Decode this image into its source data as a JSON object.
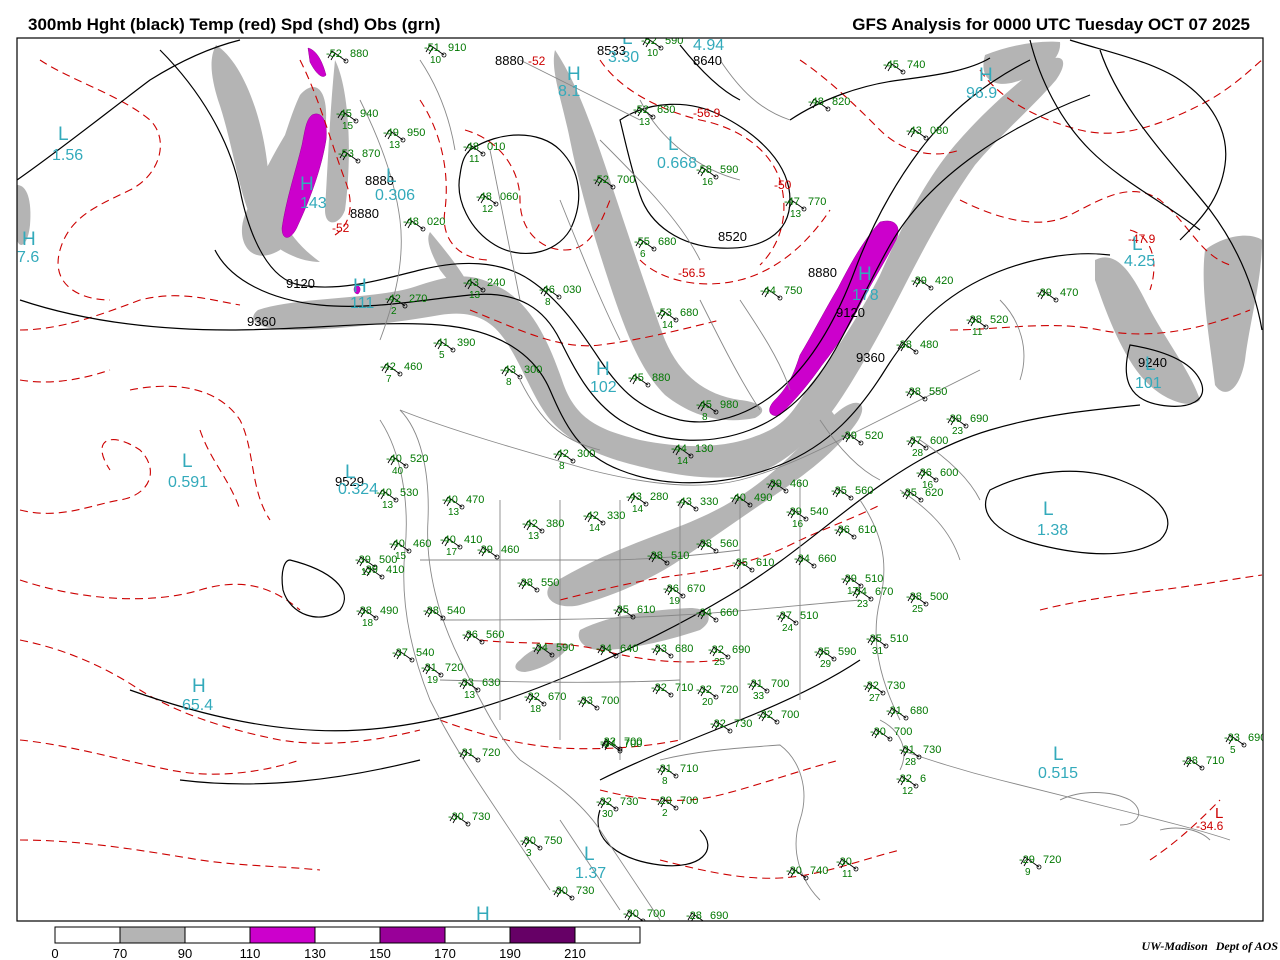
{
  "header": {
    "left_title": "300mb Hght (black) Temp (red) Spd (shd) Obs (grn)",
    "right_title": "GFS Analysis for 0000 UTC Tuesday  OCT 07 2025"
  },
  "credit": {
    "institution": "UW-Madison",
    "department": "Dept of AOS"
  },
  "colors": {
    "height_contour": "#000000",
    "temp_contour": "#cc0000",
    "speed_70_90": "#b4b4b4",
    "speed_110_130": "#cc00cc",
    "speed_150_170": "#990099",
    "speed_190_210": "#660066",
    "obs": "#007700",
    "extrema": "#33aabb",
    "borders": "#888888"
  },
  "colorbar": {
    "ticks": [
      "0",
      "70",
      "90",
      "110",
      "130",
      "150",
      "170",
      "190",
      "210"
    ],
    "segments": [
      "#ffffff",
      "#b4b4b4",
      "#ffffff",
      "#cc00cc",
      "#ffffff",
      "#990099",
      "#ffffff",
      "#660066",
      "#ffffff"
    ]
  },
  "height_labels": [
    "8880",
    "8533",
    "8640",
    "8880",
    "8880",
    "8520",
    "9120",
    "9360",
    "9529",
    "8880",
    "9120",
    "9360",
    "9240"
  ],
  "temp_labels": [
    "-52",
    "-56.9",
    "-50",
    "-56.5",
    "-52",
    "-47.9",
    "-34.6"
  ],
  "extrema": [
    {
      "letter": "L",
      "value": "1.56"
    },
    {
      "letter": "H",
      "value": "7.6"
    },
    {
      "letter": "H",
      "value": "143"
    },
    {
      "letter": "H",
      "value": "111"
    },
    {
      "letter": "H",
      "value": "8.1"
    },
    {
      "letter": "L",
      "value": "3.30"
    },
    {
      "letter": "L",
      "value": "0.306"
    },
    {
      "letter": "L",
      "value": "0.668"
    },
    {
      "letter": "L",
      "value": "4.94"
    },
    {
      "letter": "H",
      "value": "96.9"
    },
    {
      "letter": "L",
      "value": "4.25"
    },
    {
      "letter": "L",
      "value": "101"
    },
    {
      "letter": "H",
      "value": "178"
    },
    {
      "letter": "H",
      "value": "102"
    },
    {
      "letter": "L",
      "value": "0.591"
    },
    {
      "letter": "L",
      "value": "0.324"
    },
    {
      "letter": "L",
      "value": "1.38"
    },
    {
      "letter": "H",
      "value": "65.4"
    },
    {
      "letter": "L",
      "value": "1.37"
    },
    {
      "letter": "L",
      "value": "0.515"
    },
    {
      "letter": "L",
      "value": ""
    },
    {
      "letter": "H",
      "value": ""
    }
  ],
  "observations": [
    {
      "temp": "-52",
      "hgt": "880",
      "dir": ""
    },
    {
      "temp": "-51",
      "hgt": "910",
      "dir": "10"
    },
    {
      "temp": "-52",
      "hgt": "590",
      "dir": "10"
    },
    {
      "temp": "-45",
      "hgt": "740",
      "dir": ""
    },
    {
      "temp": "-48",
      "hgt": "820",
      "dir": ""
    },
    {
      "temp": "-45",
      "hgt": "940",
      "dir": "15"
    },
    {
      "temp": "-49",
      "hgt": "950",
      "dir": "13"
    },
    {
      "temp": "-53",
      "hgt": "870",
      "dir": ""
    },
    {
      "temp": "-52",
      "hgt": "630",
      "dir": "13"
    },
    {
      "temp": "-43",
      "hgt": "080",
      "dir": ""
    },
    {
      "temp": "-48",
      "hgt": "010",
      "dir": "11"
    },
    {
      "temp": "-52",
      "hgt": "700",
      "dir": ""
    },
    {
      "temp": "-58",
      "hgt": "590",
      "dir": "16"
    },
    {
      "temp": "-48",
      "hgt": "060",
      "dir": "12"
    },
    {
      "temp": "-47",
      "hgt": "770",
      "dir": "13"
    },
    {
      "temp": "-48",
      "hgt": "020",
      "dir": ""
    },
    {
      "temp": "-55",
      "hgt": "680",
      "dir": "6"
    },
    {
      "temp": "-39",
      "hgt": "420",
      "dir": ""
    },
    {
      "temp": "-43",
      "hgt": "240",
      "dir": "13"
    },
    {
      "temp": "-46",
      "hgt": "030",
      "dir": "8"
    },
    {
      "temp": "-44",
      "hgt": "750",
      "dir": ""
    },
    {
      "temp": "-39",
      "hgt": "470",
      "dir": ""
    },
    {
      "temp": "-42",
      "hgt": "270",
      "dir": "2"
    },
    {
      "temp": "-53",
      "hgt": "680",
      "dir": "14"
    },
    {
      "temp": "-38",
      "hgt": "520",
      "dir": "11"
    },
    {
      "temp": "-41",
      "hgt": "390",
      "dir": "5"
    },
    {
      "temp": "-38",
      "hgt": "480",
      "dir": ""
    },
    {
      "temp": "-42",
      "hgt": "460",
      "dir": "7"
    },
    {
      "temp": "-43",
      "hgt": "300",
      "dir": "8"
    },
    {
      "temp": "-45",
      "hgt": "880",
      "dir": ""
    },
    {
      "temp": "-38",
      "hgt": "550",
      "dir": ""
    },
    {
      "temp": "-45",
      "hgt": "980",
      "dir": "8"
    },
    {
      "temp": "-39",
      "hgt": "690",
      "dir": "23"
    },
    {
      "temp": "-39",
      "hgt": "520",
      "dir": ""
    },
    {
      "temp": "-37",
      "hgt": "600",
      "dir": "28"
    },
    {
      "temp": "-40",
      "hgt": "520",
      "dir": "40"
    },
    {
      "temp": "-42",
      "hgt": "300",
      "dir": "8"
    },
    {
      "temp": "-44",
      "hgt": "130",
      "dir": "14"
    },
    {
      "temp": "-36",
      "hgt": "600",
      "dir": "16"
    },
    {
      "temp": "-40",
      "hgt": "530",
      "dir": "13"
    },
    {
      "temp": "-40",
      "hgt": "470",
      "dir": "13"
    },
    {
      "temp": "-43",
      "hgt": "280",
      "dir": "14"
    },
    {
      "temp": "-43",
      "hgt": "330",
      "dir": ""
    },
    {
      "temp": "-40",
      "hgt": "490",
      "dir": ""
    },
    {
      "temp": "-39",
      "hgt": "460",
      "dir": ""
    },
    {
      "temp": "-35",
      "hgt": "560",
      "dir": ""
    },
    {
      "temp": "-35",
      "hgt": "620",
      "dir": ""
    },
    {
      "temp": "-42",
      "hgt": "380",
      "dir": "13"
    },
    {
      "temp": "-42",
      "hgt": "330",
      "dir": "14"
    },
    {
      "temp": "-39",
      "hgt": "540",
      "dir": "16"
    },
    {
      "temp": "-36",
      "hgt": "610",
      "dir": ""
    },
    {
      "temp": "-39",
      "hgt": "500",
      "dir": "17"
    },
    {
      "temp": "-40",
      "hgt": "460",
      "dir": "15"
    },
    {
      "temp": "-40",
      "hgt": "410",
      "dir": "17"
    },
    {
      "temp": "-39",
      "hgt": "460",
      "dir": ""
    },
    {
      "temp": "-38",
      "hgt": "510",
      "dir": ""
    },
    {
      "temp": "-38",
      "hgt": "560",
      "dir": ""
    },
    {
      "temp": "-35",
      "hgt": "610",
      "dir": ""
    },
    {
      "temp": "-34",
      "hgt": "660",
      "dir": ""
    },
    {
      "temp": "-39",
      "hgt": "510",
      "dir": "17"
    },
    {
      "temp": "-39",
      "hgt": "410",
      "dir": ""
    },
    {
      "temp": "-38",
      "hgt": "550",
      "dir": ""
    },
    {
      "temp": "-36",
      "hgt": "670",
      "dir": "19"
    },
    {
      "temp": "-34",
      "hgt": "670",
      "dir": "23"
    },
    {
      "temp": "-38",
      "hgt": "500",
      "dir": "25"
    },
    {
      "temp": "-38",
      "hgt": "490",
      "dir": "18"
    },
    {
      "temp": "-38",
      "hgt": "540",
      "dir": ""
    },
    {
      "temp": "-35",
      "hgt": "610",
      "dir": ""
    },
    {
      "temp": "-34",
      "hgt": "660",
      "dir": ""
    },
    {
      "temp": "-37",
      "hgt": "510",
      "dir": "24"
    },
    {
      "temp": "-36",
      "hgt": "560",
      "dir": ""
    },
    {
      "temp": "-34",
      "hgt": "590",
      "dir": ""
    },
    {
      "temp": "-34",
      "hgt": "640",
      "dir": ""
    },
    {
      "temp": "-33",
      "hgt": "680",
      "dir": ""
    },
    {
      "temp": "-32",
      "hgt": "690",
      "dir": "25"
    },
    {
      "temp": "-35",
      "hgt": "510",
      "dir": "31"
    },
    {
      "temp": "-37",
      "hgt": "540",
      "dir": ""
    },
    {
      "temp": "-31",
      "hgt": "720",
      "dir": "19"
    },
    {
      "temp": "-32",
      "hgt": "700",
      "dir": ""
    },
    {
      "temp": "-35",
      "hgt": "590",
      "dir": "29"
    },
    {
      "temp": "-33",
      "hgt": "630",
      "dir": "13"
    },
    {
      "temp": "-32",
      "hgt": "670",
      "dir": "18"
    },
    {
      "temp": "-33",
      "hgt": "700",
      "dir": ""
    },
    {
      "temp": "-32",
      "hgt": "710",
      "dir": ""
    },
    {
      "temp": "-32",
      "hgt": "720",
      "dir": "20"
    },
    {
      "temp": "-31",
      "hgt": "700",
      "dir": "33"
    },
    {
      "temp": "-32",
      "hgt": "730",
      "dir": "27"
    },
    {
      "temp": "-32",
      "hgt": "730",
      "dir": ""
    },
    {
      "temp": "-32",
      "hgt": "700",
      "dir": ""
    },
    {
      "temp": "-31",
      "hgt": "680",
      "dir": ""
    },
    {
      "temp": "-31",
      "hgt": "720",
      "dir": ""
    },
    {
      "temp": "-34",
      "hgt": "700",
      "dir": ""
    },
    {
      "temp": "-30",
      "hgt": "700",
      "dir": ""
    },
    {
      "temp": "-31",
      "hgt": "730",
      "dir": "28"
    },
    {
      "temp": "-31",
      "hgt": "710",
      "dir": "8"
    },
    {
      "temp": "-32",
      "hgt": "6",
      "dir": "12"
    },
    {
      "temp": "-33",
      "hgt": "690",
      "dir": "5"
    },
    {
      "temp": "-28",
      "hgt": "710",
      "dir": ""
    },
    {
      "temp": "-30",
      "hgt": "730",
      "dir": ""
    },
    {
      "temp": "-32",
      "hgt": "730",
      "dir": "30"
    },
    {
      "temp": "-29",
      "hgt": "700",
      "dir": "2"
    },
    {
      "temp": "-30",
      "hgt": "750",
      "dir": "3"
    },
    {
      "temp": "-30",
      "hgt": "740",
      "dir": ""
    },
    {
      "temp": "-30",
      "hgt": "",
      "dir": "11"
    },
    {
      "temp": "-29",
      "hgt": "720",
      "dir": "9"
    },
    {
      "temp": "-30",
      "hgt": "730",
      "dir": ""
    },
    {
      "temp": "-30",
      "hgt": "700",
      "dir": ""
    },
    {
      "temp": "-28",
      "hgt": "690",
      "dir": ""
    }
  ]
}
